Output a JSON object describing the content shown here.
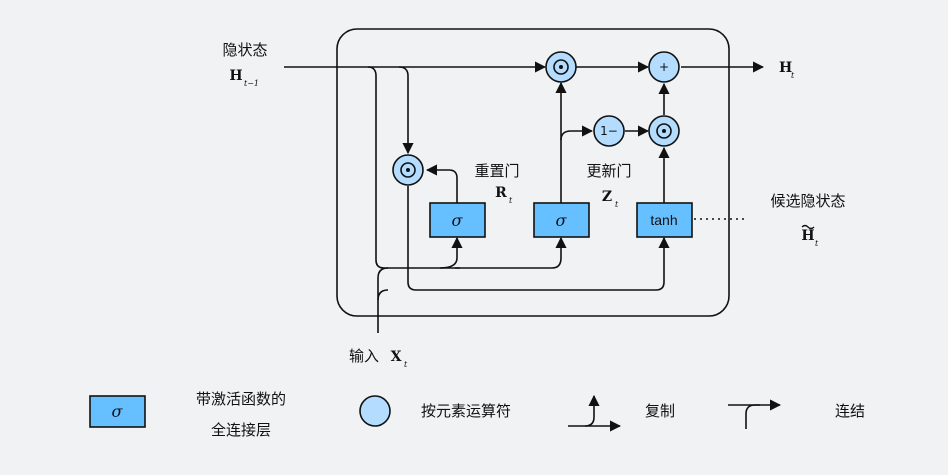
{
  "labels": {
    "hidden_state": "隐状态",
    "hidden_prev_symbol": "H",
    "hidden_prev_sub": "t−1",
    "reset_gate": "重置门",
    "reset_symbol": "R",
    "reset_sub": "t",
    "update_gate": "更新门",
    "update_symbol": "Z",
    "update_sub": "t",
    "candidate_state": "候选隐状态",
    "candidate_symbol": "H",
    "candidate_sub": "t",
    "input": "输入",
    "input_symbol": "X",
    "input_sub": "t",
    "output_symbol": "H",
    "output_sub": "t"
  },
  "nodes": {
    "sigma_reset": "σ",
    "sigma_update": "σ",
    "tanh": "tanh",
    "one_minus": "1−",
    "plus": "+"
  },
  "legend": {
    "fc_label_line1": "带激活函数的",
    "fc_label_line2": "全连接层",
    "fc_symbol": "σ",
    "elementwise_label": "按元素运算符",
    "copy_label": "复制",
    "concat_label": "连结"
  },
  "colors": {
    "gate_fill": "#66bfff",
    "op_fill": "#b3dcff",
    "stroke": "#111111",
    "background": "#f1f2f4"
  }
}
